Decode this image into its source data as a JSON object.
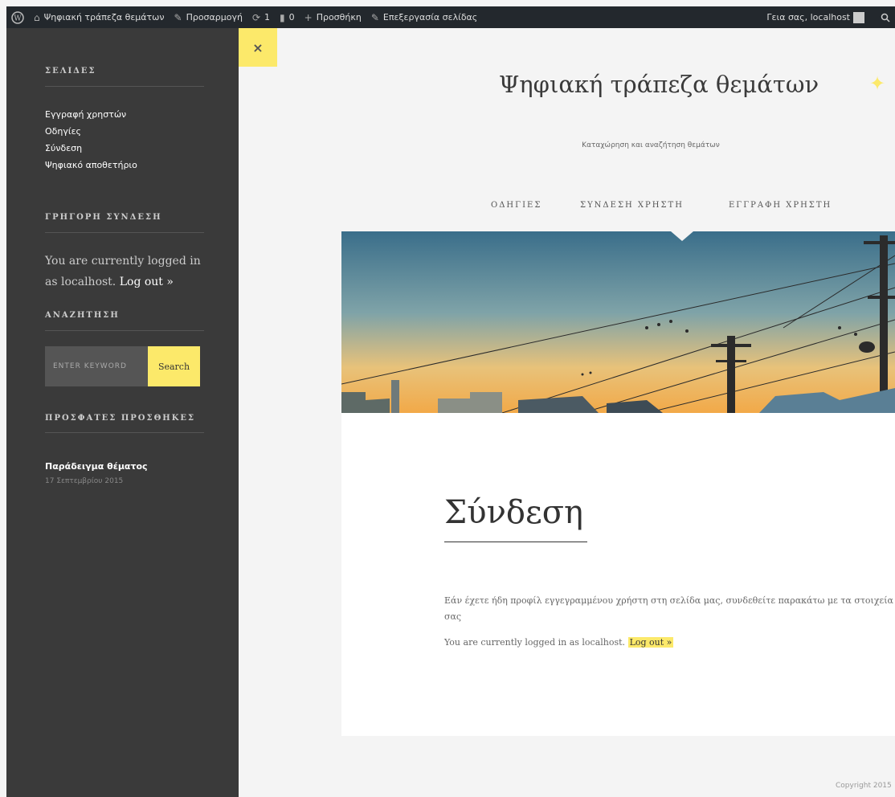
{
  "adminbar": {
    "site_name": "Ψηφιακή τράπεζα θεμάτων",
    "customize": "Προσαρμογή",
    "updates": "1",
    "comments": "0",
    "new": "Προσθήκη",
    "edit": "Επεξεργασία σελίδας",
    "greeting": "Γεια σας, localhost"
  },
  "sidebar": {
    "pages_title": "ΣΕΛΙΔΕΣ",
    "pages": [
      "Εγγραφή χρηστών",
      "Οδηγίες",
      "Σύνδεση",
      "Ψηφιακό αποθετήριο"
    ],
    "quick_login_title": "ΓΡΗΓΟΡΗ ΣΥΝΔΕΣΗ",
    "logged_text": "You are currently logged in as localhost.",
    "logout": "Log out »",
    "search_title": "ΑΝΑΖΗΤΗΣΗ",
    "search_placeholder": "ENTER KEYWORD",
    "search_button": "Search",
    "recent_title": "ΠΡΟΣΦΑΤΕΣ ΠΡΟΣΘΗΚΕΣ",
    "recent_post": "Παράδειγμα θέματος",
    "recent_date": "17 Σεπτεμβρίου 2015"
  },
  "close_label": "×",
  "header": {
    "title": "Ψηφιακή τράπεζα θεμάτων",
    "tagline": "Καταχώρηση και αναζήτηση θεμάτων",
    "menu": [
      "ΟΔΗΓΙΕΣ",
      "ΣΥΝΔΕΣΗ ΧΡΗΣΤΗ",
      "ΕΓΓΡΑΦΗ ΧΡΗΣΤΗ"
    ]
  },
  "content": {
    "title": "Σύνδεση",
    "intro": "Εάν έχετε ήδη προφίλ εγγεγραμμένου χρήστη στη σελίδα μας, συνδεθείτε παρακάτω με τα στοιχεία σας",
    "logged_text": "You are currently logged in as localhost.",
    "logout": "Log out »"
  },
  "footer": {
    "copyright": "Copyright 2015"
  },
  "colors": {
    "accent": "#fce96a",
    "sidebar": "#3a3a3a",
    "adminbar": "#23282d"
  }
}
